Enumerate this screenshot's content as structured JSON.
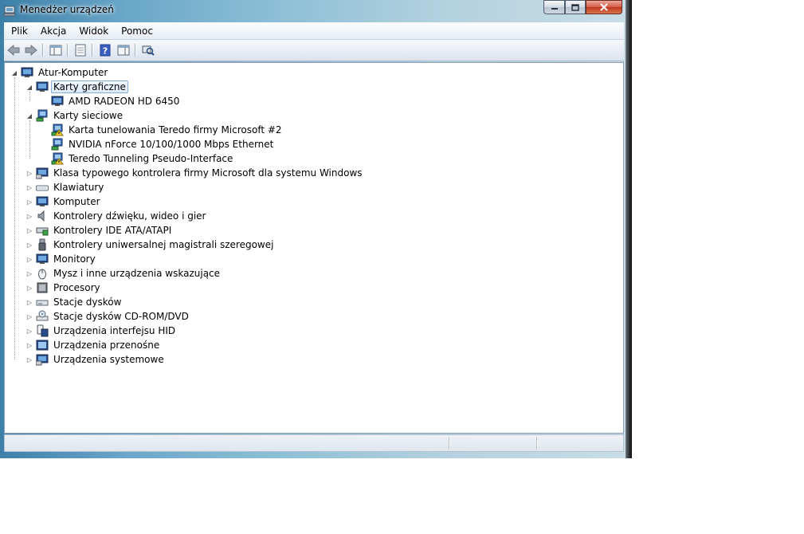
{
  "window": {
    "title": "Menedżer urządzeń"
  },
  "menu": [
    "Plik",
    "Akcja",
    "Widok",
    "Pomoc"
  ],
  "toolbar": {
    "buttons": [
      "back-icon",
      "forward-icon",
      "show-hide-console-tree-icon",
      "properties-icon",
      "help-icon",
      "action-pane-icon",
      "scan-hardware-icon"
    ]
  },
  "tree": {
    "root": "Atur-Komputer",
    "categories": [
      {
        "label": "Karty graficzne",
        "expanded": true,
        "selected": true,
        "icon": "display-adapter-icon",
        "children": [
          {
            "label": "AMD RADEON HD 6450",
            "icon": "display-adapter-icon",
            "warning": false
          }
        ]
      },
      {
        "label": "Karty sieciowe",
        "expanded": true,
        "icon": "network-adapter-icon",
        "children": [
          {
            "label": "Karta tunelowania Teredo firmy Microsoft #2",
            "icon": "network-adapter-icon",
            "warning": true
          },
          {
            "label": "NVIDIA nForce 10/100/1000 Mbps Ethernet",
            "icon": "network-adapter-icon",
            "warning": false
          },
          {
            "label": "Teredo Tunneling Pseudo-Interface",
            "icon": "network-adapter-icon",
            "warning": true
          }
        ]
      },
      {
        "label": "Klasa typowego kontrolera firmy Microsoft dla systemu Windows",
        "icon": "controller-icon"
      },
      {
        "label": "Klawiatury",
        "icon": "keyboard-icon"
      },
      {
        "label": "Komputer",
        "icon": "computer-icon"
      },
      {
        "label": "Kontrolery dźwięku, wideo i gier",
        "icon": "speaker-icon"
      },
      {
        "label": "Kontrolery IDE ATA/ATAPI",
        "icon": "ide-controller-icon"
      },
      {
        "label": "Kontrolery uniwersalnej magistrali szeregowej",
        "icon": "usb-icon"
      },
      {
        "label": "Monitory",
        "icon": "monitor-icon"
      },
      {
        "label": "Mysz i inne urządzenia wskazujące",
        "icon": "mouse-icon"
      },
      {
        "label": "Procesory",
        "icon": "processor-icon"
      },
      {
        "label": "Stacje dysków",
        "icon": "disk-drive-icon"
      },
      {
        "label": "Stacje dysków CD-ROM/DVD",
        "icon": "cdrom-icon"
      },
      {
        "label": "Urządzenia interfejsu HID",
        "icon": "hid-icon"
      },
      {
        "label": "Urządzenia przenośne",
        "icon": "portable-device-icon"
      },
      {
        "label": "Urządzenia systemowe",
        "icon": "system-device-icon"
      }
    ]
  }
}
